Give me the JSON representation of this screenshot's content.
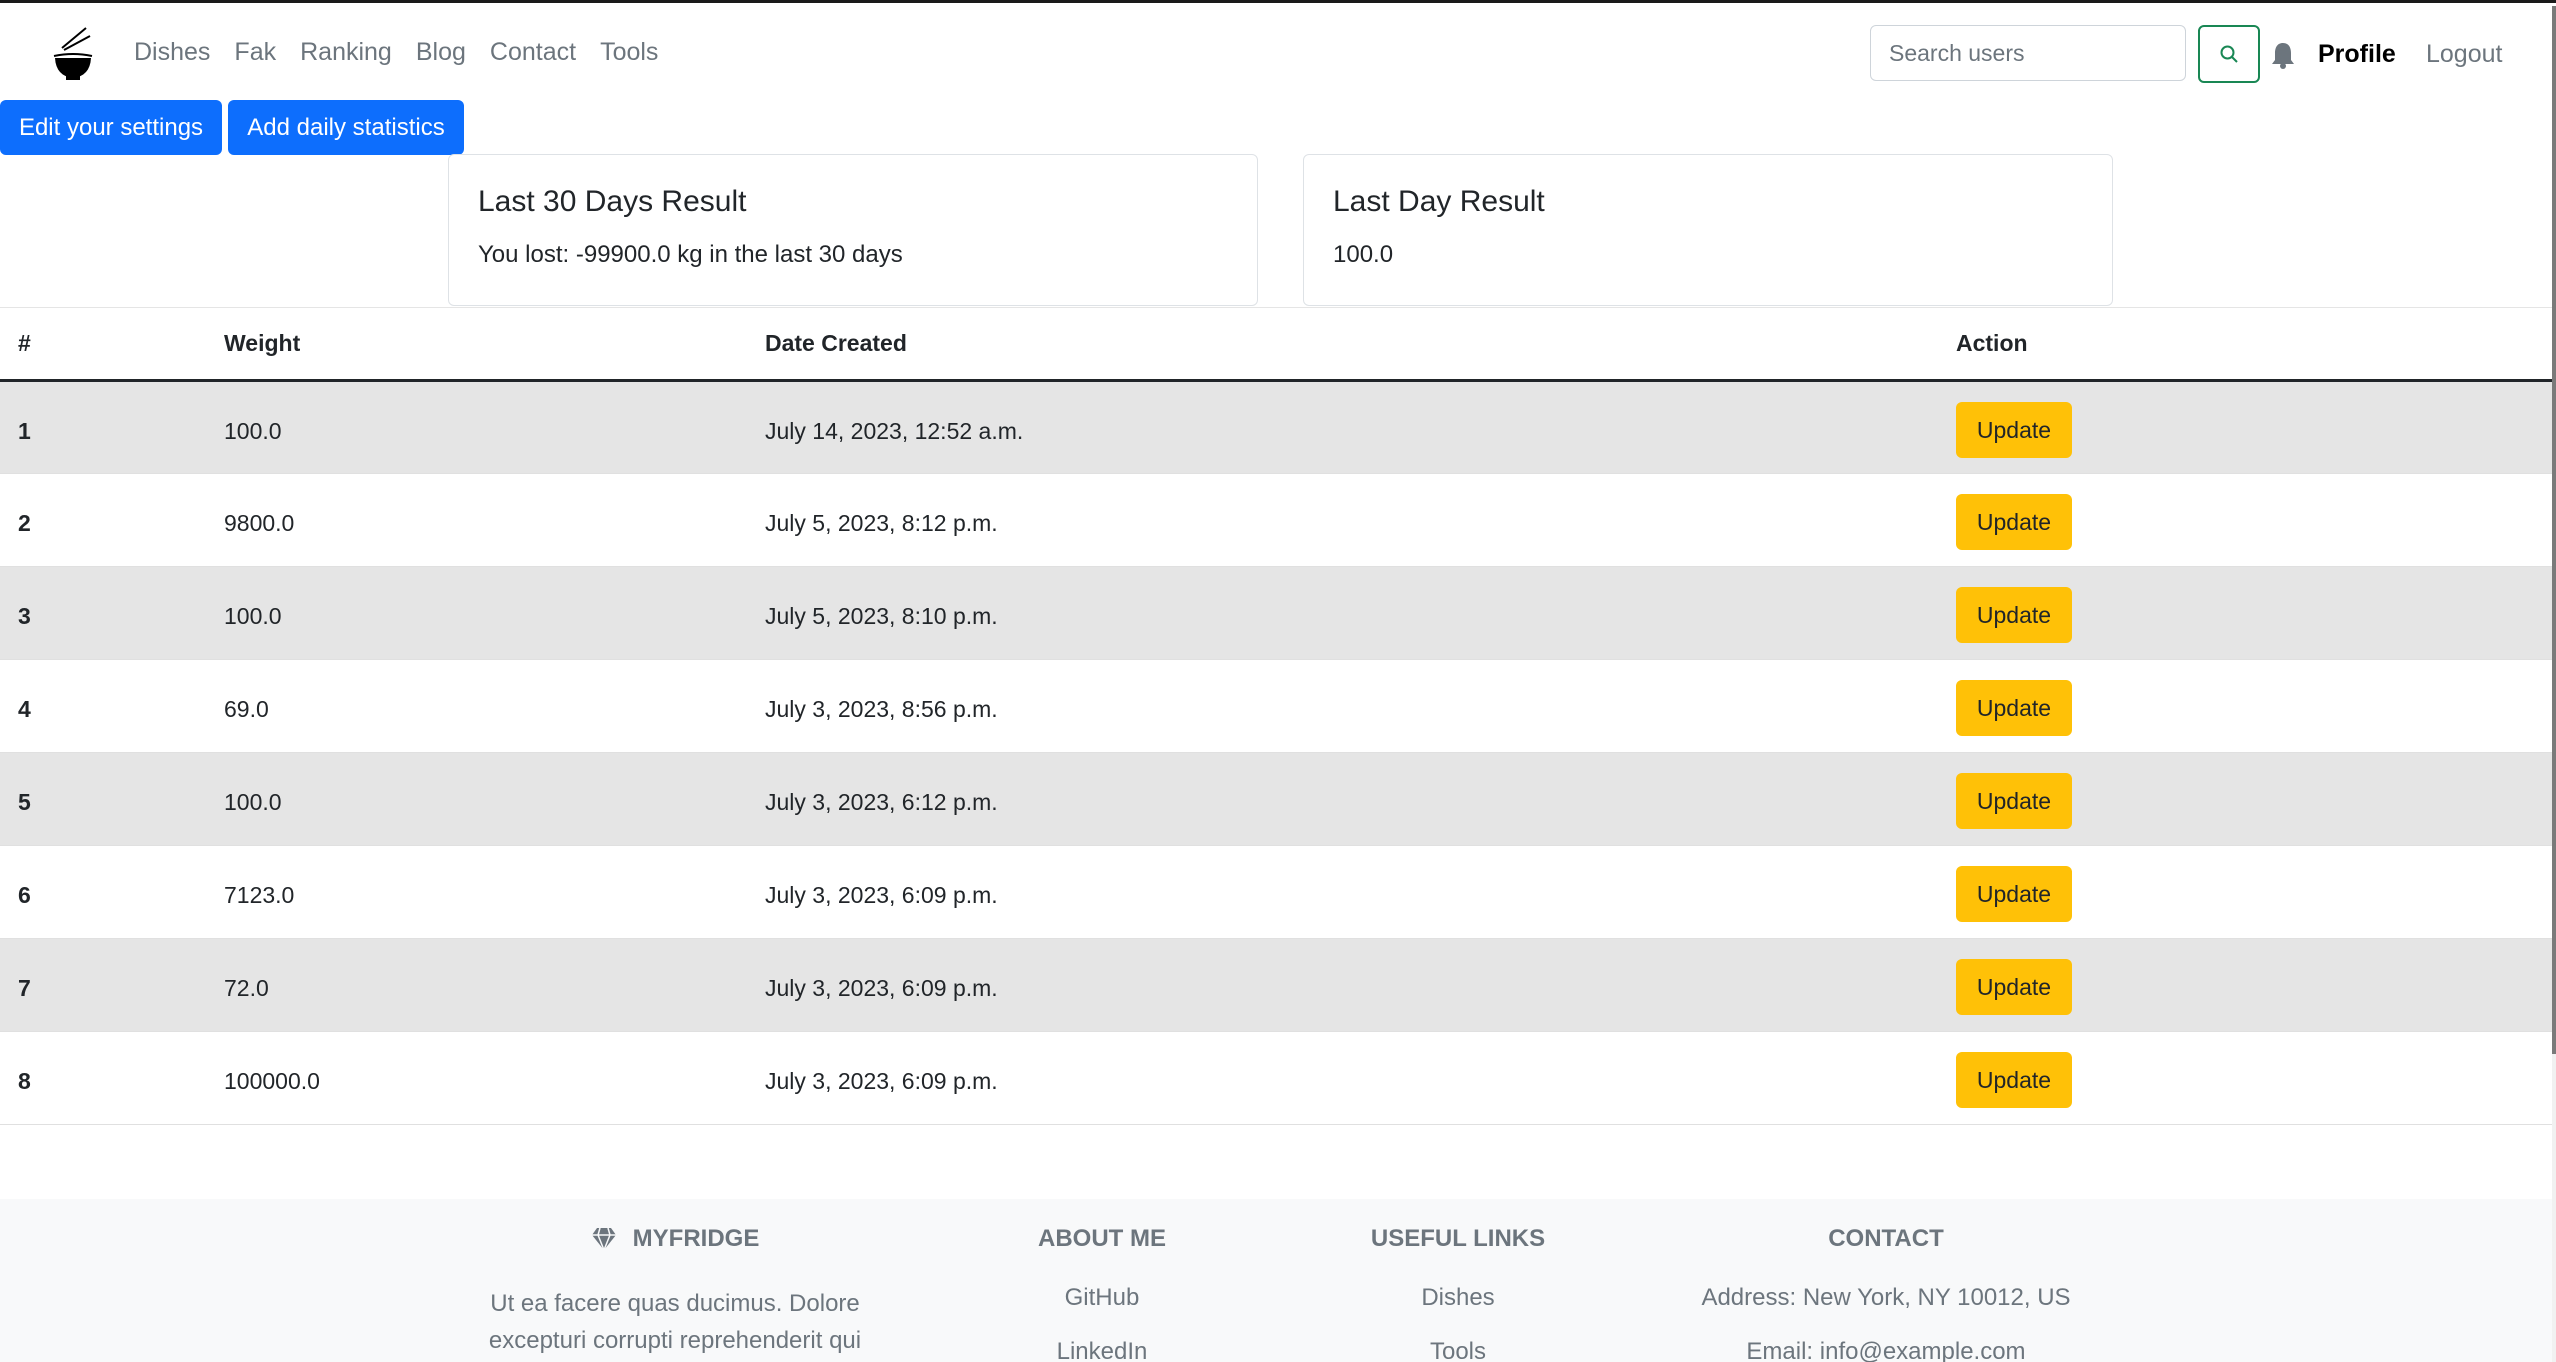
{
  "nav": {
    "links": [
      "Dishes",
      "Fak",
      "Ranking",
      "Blog",
      "Contact",
      "Tools"
    ],
    "search_placeholder": "Search users",
    "profile": "Profile",
    "logout": "Logout",
    "search_icon": "search-icon",
    "bell_icon": "bell-icon",
    "logo_icon": "noodle-bowl-icon"
  },
  "actions": {
    "edit_settings": "Edit your settings",
    "add_stats": "Add daily statistics"
  },
  "cards": {
    "last30": {
      "title": "Last 30 Days Result",
      "text": "You lost: -99900.0 kg in the last 30 days"
    },
    "lastday": {
      "title": "Last Day Result",
      "text": "100.0"
    }
  },
  "table": {
    "headers": [
      "#",
      "Weight",
      "Date Created",
      "Action"
    ],
    "rows": [
      {
        "num": "1",
        "weight": "100.0",
        "date": "July 14, 2023, 12:52 a.m.",
        "action": "Update"
      },
      {
        "num": "2",
        "weight": "9800.0",
        "date": "July 5, 2023, 8:12 p.m.",
        "action": "Update"
      },
      {
        "num": "3",
        "weight": "100.0",
        "date": "July 5, 2023, 8:10 p.m.",
        "action": "Update"
      },
      {
        "num": "4",
        "weight": "69.0",
        "date": "July 3, 2023, 8:56 p.m.",
        "action": "Update"
      },
      {
        "num": "5",
        "weight": "100.0",
        "date": "July 3, 2023, 6:12 p.m.",
        "action": "Update"
      },
      {
        "num": "6",
        "weight": "7123.0",
        "date": "July 3, 2023, 6:09 p.m.",
        "action": "Update"
      },
      {
        "num": "7",
        "weight": "72.0",
        "date": "July 3, 2023, 6:09 p.m.",
        "action": "Update"
      },
      {
        "num": "8",
        "weight": "100000.0",
        "date": "July 3, 2023, 6:09 p.m.",
        "action": "Update"
      }
    ]
  },
  "footer": {
    "brand": {
      "title": "MYFRIDGE",
      "icon": "gem-icon",
      "text_lines": [
        "Ut ea facere quas ducimus. Dolore",
        "excepturi corrupti reprehenderit qui"
      ]
    },
    "about": {
      "title": "ABOUT ME",
      "links": [
        "GitHub",
        "LinkedIn"
      ]
    },
    "useful": {
      "title": "USEFUL LINKS",
      "links": [
        "Dishes",
        "Tools"
      ]
    },
    "contact": {
      "title": "CONTACT",
      "lines": [
        "Address: New York, NY 10012, US",
        "Email: info@example.com"
      ]
    }
  },
  "colors": {
    "primary": "#0d6efd",
    "warning": "#ffc107",
    "success": "#198754",
    "muted": "#6c757d"
  }
}
